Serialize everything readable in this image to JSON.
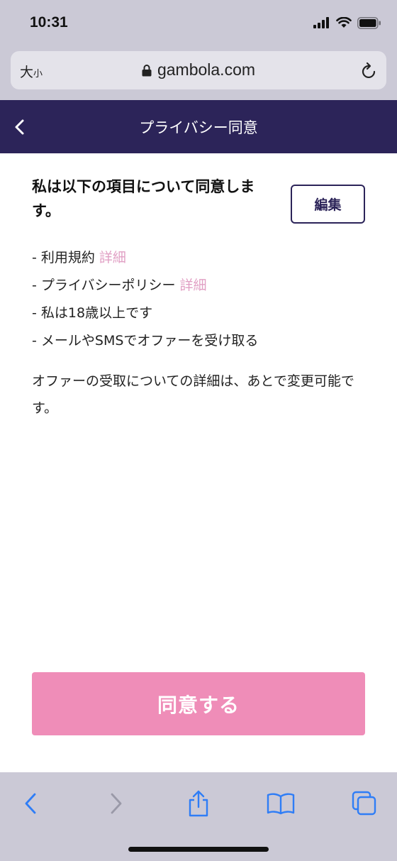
{
  "status_bar": {
    "time": "10:31"
  },
  "browser": {
    "text_size_large": "大",
    "text_size_small": "小",
    "url": "gambola.com"
  },
  "header": {
    "title": "プライバシー同意"
  },
  "main": {
    "heading": "私は以下の項目について同意します。",
    "edit_label": "編集",
    "terms": [
      {
        "text": "- 利用規約",
        "link": "詳細"
      },
      {
        "text": "- プライバシーポリシー",
        "link": "詳細"
      },
      {
        "text": "- 私は18歳以上です"
      },
      {
        "text": "- メールやSMSでオファーを受け取る"
      }
    ],
    "note": "オファーの受取についての詳細は、あとで変更可能です。",
    "agree_label": "同意する"
  },
  "colors": {
    "header_bg": "#2c2459",
    "accent_pink": "#ef8db8",
    "link_pink": "#e19fc4",
    "browser_chrome": "#cbc9d6",
    "ios_blue": "#2f7df6"
  }
}
